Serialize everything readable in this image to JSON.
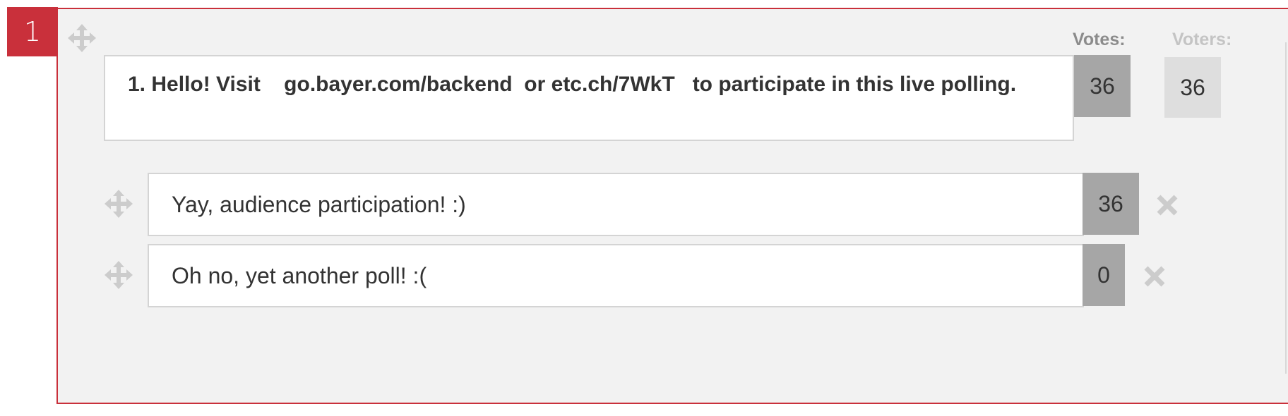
{
  "poll": {
    "number": "1",
    "question": "1. Hello! Visit    go.bayer.com/backend  or etc.ch/7WkT   to participate in this live polling.",
    "votes_label": "Votes:",
    "voters_label": "Voters:",
    "votes_count": "36",
    "voters_count": "36",
    "answers": [
      {
        "text": "Yay, audience participation! :)",
        "votes": "36"
      },
      {
        "text": "Oh no, yet another poll! :(",
        "votes": "0"
      }
    ]
  },
  "colors": {
    "accent": "#c9303b",
    "card_background": "#f2f2f2",
    "count_dark": "#a6a6a6",
    "count_light": "#dedede",
    "icon_gray": "#cccccc"
  },
  "icons": [
    "move-icon",
    "delete-icon"
  ]
}
